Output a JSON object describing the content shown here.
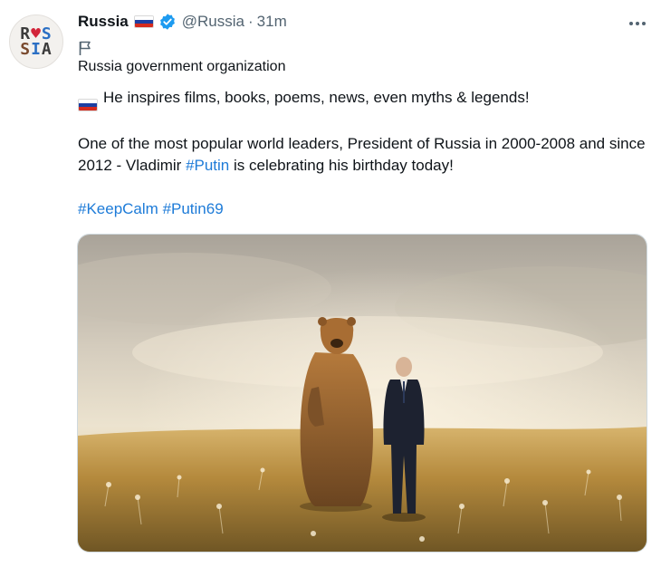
{
  "account": {
    "name": "Russia",
    "handle": "@Russia",
    "separator": "·",
    "time": "31m",
    "avatar_text": {
      "line1": [
        "R",
        "♥",
        "S"
      ],
      "line2": [
        "S",
        "I",
        "A"
      ]
    },
    "verified_icon": "verified-badge-icon",
    "flag_icon": "russia-flag-icon"
  },
  "label": {
    "icon": "flag-outline-icon",
    "text": "Russia government organization"
  },
  "tweet": {
    "line1": "He inspires films, books, poems, news, even myths & legends!",
    "line2_before": "One of the most popular world leaders, President of Russia in 2000-2008 and since 2012 - Vladimir ",
    "hashtag_putin": "#Putin",
    "line2_after": " is celebrating his birthday today!",
    "hashtag_keepcalm": "#KeepCalm",
    "hashtag_putin69": "#Putin69"
  },
  "media": {
    "description_icon": "photo-bear-and-man-in-field"
  },
  "colors": {
    "link": "#1d7bd8",
    "verified": "#1d9bf0",
    "flag_white": "#ffffff",
    "flag_blue": "#1c3fa3",
    "flag_red": "#d52b1e"
  }
}
